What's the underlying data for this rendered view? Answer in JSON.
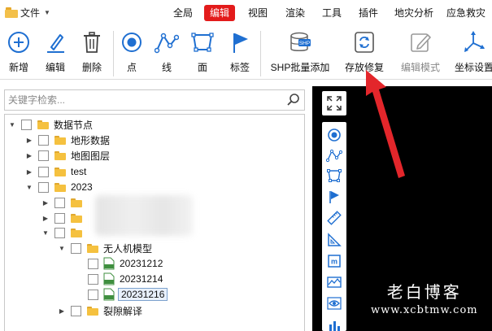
{
  "menubar": {
    "file_label": "文件",
    "items": [
      "全局",
      "编辑",
      "视图",
      "渲染",
      "工具",
      "插件",
      "地灾分析",
      "应急救灾"
    ],
    "active_index": 1
  },
  "ribbon": {
    "buttons": [
      {
        "label": "新增",
        "icon": "plus-circle-icon"
      },
      {
        "label": "编辑",
        "icon": "pen-icon"
      },
      {
        "label": "删除",
        "icon": "trash-icon"
      },
      {
        "label": "点",
        "icon": "point-icon"
      },
      {
        "label": "线",
        "icon": "polyline-icon"
      },
      {
        "label": "面",
        "icon": "polygon-icon"
      },
      {
        "label": "标签",
        "icon": "flag-icon"
      },
      {
        "label": "SHP批量添加",
        "icon": "shp-database-icon"
      },
      {
        "label": "存放修复",
        "icon": "repair-icon"
      },
      {
        "label": "编辑模式",
        "icon": "edit-mode-icon",
        "disabled": true
      },
      {
        "label": "坐标设置",
        "icon": "axis-icon"
      }
    ]
  },
  "search": {
    "placeholder": "关键字检索..."
  },
  "tree": {
    "root": "数据节点",
    "terrain": "地形数据",
    "map_layers": "地图图层",
    "test": "test",
    "year": "2023",
    "drone": "无人机模型",
    "files": [
      "20231212",
      "20231214",
      "20231216"
    ],
    "crack": "裂隙解译"
  },
  "watermark": {
    "line1": "老白博客",
    "line2": "www.xcbtmw.com"
  },
  "colors": {
    "accent": "#e31b1b",
    "blue": "#1f6fd1",
    "folder": "#f5c13f"
  }
}
